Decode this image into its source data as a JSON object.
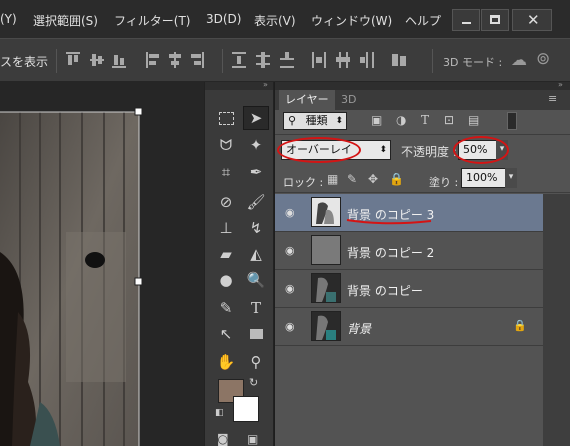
{
  "menubar": {
    "items": [
      "(Y)",
      "選択範囲(S)",
      "フィルター(T)",
      "3D(D)",
      "表示(V)",
      "ウィンドウ(W)",
      "ヘルプ"
    ],
    "window_buttons": [
      "minimize-icon",
      "restore-icon",
      "close-icon"
    ]
  },
  "options_bar": {
    "show_transform_label": "スを表示",
    "mode_3d_label": "3D モード :"
  },
  "layers_panel": {
    "tabs": [
      "レイヤー",
      "3D"
    ],
    "filter_label": "種類",
    "blend_mode": "オーバーレイ",
    "opacity_label": "不透明度 :",
    "opacity_value": "50%",
    "lock_label": "ロック :",
    "fill_label": "塗り :",
    "fill_value": "100%",
    "layers": [
      {
        "name": "背景 のコピー 3",
        "selected": true
      },
      {
        "name": "背景 のコピー 2",
        "selected": false
      },
      {
        "name": "背景 のコピー",
        "selected": false
      },
      {
        "name": "背景",
        "selected": false,
        "locked": true
      }
    ]
  },
  "colors": {
    "foreground": "#8c7565",
    "background": "#ffffff",
    "annotation": "#d41414",
    "selected_layer": "#6b7990"
  }
}
